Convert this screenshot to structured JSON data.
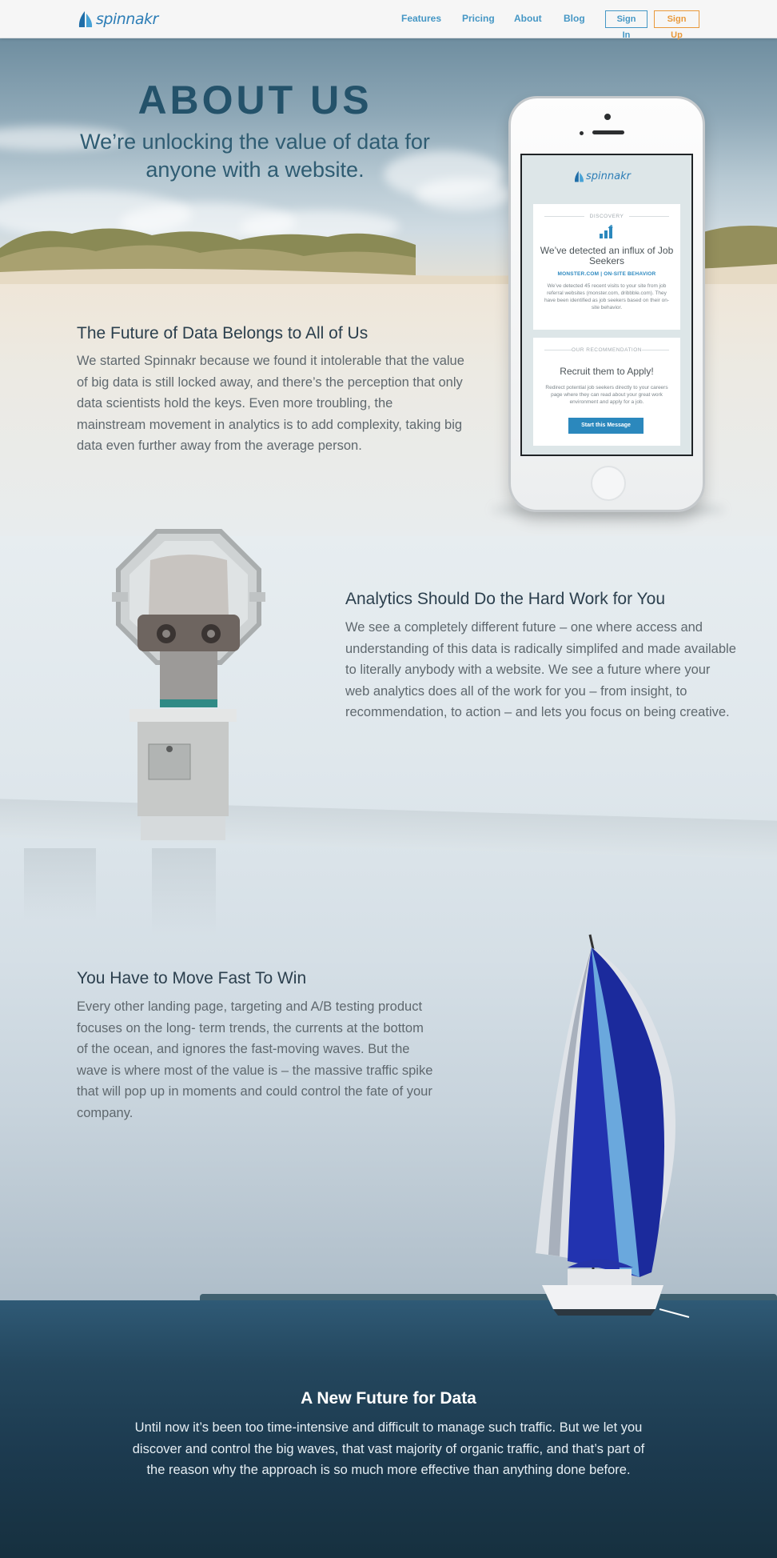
{
  "brand": {
    "name": "spinnakr",
    "accent": "#2c7db6",
    "signup_color": "#e9993b"
  },
  "nav": {
    "links": [
      "Features",
      "Pricing",
      "About",
      "Blog"
    ],
    "sign_in": "Sign In",
    "sign_up": "Sign Up"
  },
  "hero": {
    "title": "ABOUT US",
    "subtitle": "We’re unlocking the value of data for anyone with a website."
  },
  "phone": {
    "logo": "spinnakr",
    "card1": {
      "label": "DISCOVERY",
      "icon": "bar-chart-icon",
      "headline": "We’ve detected an influx of Job Seekers",
      "tags": "MONSTER.COM  |  ON-SITE BEHAVIOR",
      "body": "We’ve detected 45 recent visits to your site from job referral websites (monster.com, dribbble.com). They have been identified as job seekers based on their on-site behavior."
    },
    "card2": {
      "label": "OUR RECOMMENDATION",
      "headline": "Recruit them to Apply!",
      "body": "Redirect potential job seekers directly to your careers page where they can read about your great work environment and apply for a job.",
      "button": "Start this Message"
    }
  },
  "sections": [
    {
      "title": "The Future of Data Belongs to All of Us",
      "body": "We started Spinnakr because we found it intolerable that the value of big data is still locked away, and there’s the perception that only data scientists hold the keys. Even more troubling, the mainstream movement in analytics is to add complexity, taking big data even further away from the average person."
    },
    {
      "title": "Analytics Should Do the Hard Work for You",
      "body": "We see a completely different future – one where access and understanding of this data is radically simplifed and made available to literally anybody with a website. We see a future where your web analytics does all of the work for you – from insight, to recommendation, to action – and lets you focus on being creative."
    },
    {
      "title": "You Have to Move Fast To Win",
      "body": "Every other landing page, targeting and A/B testing product focuses on the long- term trends, the currents at the bottom of the ocean, and ignores the fast-moving waves. But the wave is where most of the value is – the massive traffic spike that will pop up in moments and could control the fate of your company."
    },
    {
      "title": "A New Future for Data",
      "body": "Until now it’s been too time-intensive and difficult to manage such traffic. But we let you discover and control the big waves, that vast majority of organic traffic, and that’s part of the reason why the approach is so much more effective than anything done before."
    }
  ]
}
